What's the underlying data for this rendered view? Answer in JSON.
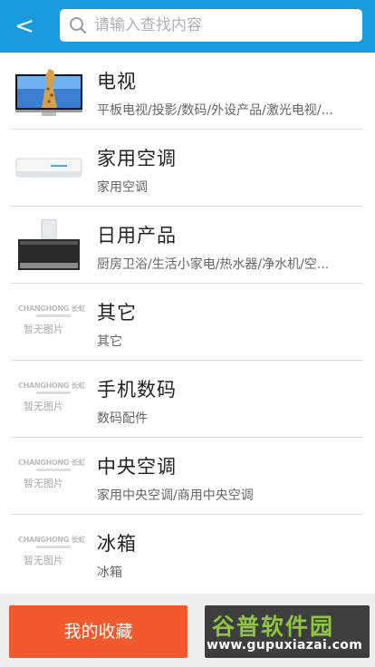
{
  "header": {
    "back_label": "<",
    "search": {
      "placeholder": "请输入查找内容",
      "value": ""
    }
  },
  "categories": [
    {
      "title": "电视",
      "subtitle": "平板电视/投影/数码/外设产品/激光电视/...",
      "image": "tv-giraffe"
    },
    {
      "title": "家用空调",
      "subtitle": "家用空调",
      "image": "air-conditioner"
    },
    {
      "title": "日用产品",
      "subtitle": "厨房卫浴/生活小家电/热水器/净水机/空...",
      "image": "range-hood"
    },
    {
      "title": "其它",
      "subtitle": "其它",
      "image": "placeholder"
    },
    {
      "title": "手机数码",
      "subtitle": "数码配件",
      "image": "placeholder"
    },
    {
      "title": "中央空调",
      "subtitle": "家用中央空调/商用中央空调",
      "image": "placeholder"
    },
    {
      "title": "冰箱",
      "subtitle": "冰箱",
      "image": "placeholder"
    }
  ],
  "placeholder": {
    "brand": "CHANGHONG 长虹",
    "text": "暂无图片"
  },
  "bottom": {
    "favorites_label": "我的收藏",
    "watermark_main": "谷普软件园",
    "watermark_url": "www.gupuxiazai.com"
  },
  "colors": {
    "header": "#1a9be0",
    "favorites": "#f25a2e"
  }
}
